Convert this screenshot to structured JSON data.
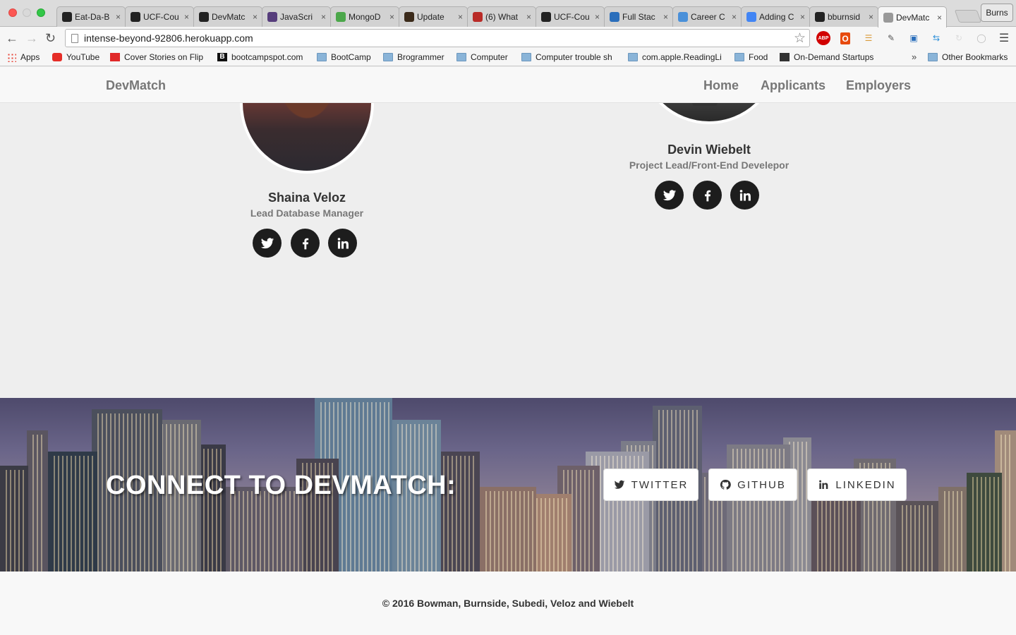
{
  "browser": {
    "tabs": [
      {
        "title": "Eat-Da-B",
        "icon": "github-icon",
        "color": "#222222"
      },
      {
        "title": "UCF-Cou",
        "icon": "github-icon",
        "color": "#222222"
      },
      {
        "title": "DevMatc",
        "icon": "github-icon",
        "color": "#222222"
      },
      {
        "title": "JavaScri",
        "icon": "bootstrap-icon",
        "color": "#563d7c"
      },
      {
        "title": "MongoD",
        "icon": "mongodb-leaf-icon",
        "color": "#4ba74a"
      },
      {
        "title": "Update",
        "icon": "mongodb-icon",
        "color": "#3b2a1a"
      },
      {
        "title": "(6) What",
        "icon": "quora-icon",
        "color": "#b92b27"
      },
      {
        "title": "UCF-Cou",
        "icon": "github-icon",
        "color": "#222222"
      },
      {
        "title": "Full Stac",
        "icon": "info-icon",
        "color": "#2a6ebb"
      },
      {
        "title": "Career C",
        "icon": "career-icon",
        "color": "#4a90d9"
      },
      {
        "title": "Adding C",
        "icon": "google-icon",
        "color": "#4285f4"
      },
      {
        "title": "bburnsid",
        "icon": "github-icon",
        "color": "#222222"
      },
      {
        "title": "DevMatc",
        "icon": "page-icon",
        "color": "#999999",
        "active": true
      }
    ],
    "profile_label": "Burns",
    "url": "intense-beyond-92806.herokuapp.com",
    "bookmarks": [
      {
        "label": "Apps",
        "icon": "apps"
      },
      {
        "label": "YouTube",
        "icon": "yt"
      },
      {
        "label": "Cover Stories on Flip",
        "icon": "flip"
      },
      {
        "label": "bootcampspot.com",
        "icon": "b"
      },
      {
        "label": "BootCamp",
        "icon": "folder"
      },
      {
        "label": "Brogrammer",
        "icon": "folder"
      },
      {
        "label": "Computer",
        "icon": "folder"
      },
      {
        "label": "Computer trouble sh",
        "icon": "folder"
      },
      {
        "label": "com.apple.ReadingLi",
        "icon": "folder"
      },
      {
        "label": "Food",
        "icon": "folder"
      },
      {
        "label": "On-Demand Startups",
        "icon": "ods"
      },
      {
        "label": "Other Bookmarks",
        "icon": "folder"
      }
    ],
    "overflow_label": "»"
  },
  "site": {
    "brand": "DevMatch",
    "nav": [
      "Home",
      "Applicants",
      "Employers"
    ]
  },
  "team": [
    {
      "name": "Shaina Veloz",
      "role": "Lead Database Manager"
    },
    {
      "name": "Devin Wiebelt",
      "role": "Project Lead/Front-End Develepor"
    }
  ],
  "banner": {
    "title": "CONNECT TO DEVMATCH:",
    "buttons": [
      {
        "label": "TWITTER",
        "icon": "twitter-icon"
      },
      {
        "label": "GITHUB",
        "icon": "github-icon"
      },
      {
        "label": "LINKEDIN",
        "icon": "linkedin-icon"
      }
    ]
  },
  "footer": {
    "copyright": "© 2016 Bowman, Burnside, Subedi, Veloz and Wiebelt"
  }
}
